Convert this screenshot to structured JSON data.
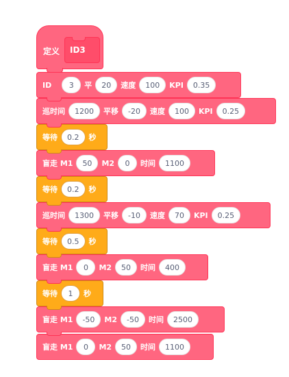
{
  "define": {
    "label": "定义",
    "proc_name": "ID3"
  },
  "blocks": [
    {
      "id": "b1",
      "kind": "id_block",
      "texts": [
        "ID",
        "3",
        "平",
        "20",
        "速度",
        "100",
        "KPI",
        "0.35"
      ]
    },
    {
      "id": "b2",
      "kind": "patrol",
      "texts": [
        "巡时间",
        "1200",
        "平移",
        "-20",
        "速度",
        "100",
        "KPI",
        "0.25"
      ]
    },
    {
      "id": "b3",
      "kind": "wait",
      "texts": [
        "等待",
        "0.2",
        "秒"
      ]
    },
    {
      "id": "b4",
      "kind": "blind",
      "texts": [
        "盲走 M1",
        "50",
        "M2",
        "0",
        "时间",
        "1100"
      ]
    },
    {
      "id": "b5",
      "kind": "wait",
      "texts": [
        "等待",
        "0.2",
        "秒"
      ]
    },
    {
      "id": "b6",
      "kind": "patrol",
      "texts": [
        "巡时间",
        "1300",
        "平移",
        "-10",
        "速度",
        "70",
        "KPI",
        "0.25"
      ]
    },
    {
      "id": "b7",
      "kind": "wait",
      "texts": [
        "等待",
        "0.5",
        "秒"
      ]
    },
    {
      "id": "b8",
      "kind": "blind",
      "texts": [
        "盲走 M1",
        "0",
        "M2",
        "50",
        "时间",
        "400"
      ]
    },
    {
      "id": "b9",
      "kind": "wait",
      "texts": [
        "等待",
        "1",
        "秒"
      ]
    },
    {
      "id": "b10",
      "kind": "blind",
      "texts": [
        "盲走 M1",
        "-50",
        "M2",
        "-50",
        "时间",
        "2500"
      ]
    },
    {
      "id": "b11",
      "kind": "blind",
      "texts": [
        "盲走 M1",
        "0",
        "M2",
        "50",
        "时间",
        "1100"
      ]
    }
  ],
  "colors": {
    "my_blocks": "#ff6680",
    "my_blocks_border": "#ff3355",
    "control": "#ffab19",
    "control_border": "#cf8b17",
    "input_text": "#575e75"
  }
}
